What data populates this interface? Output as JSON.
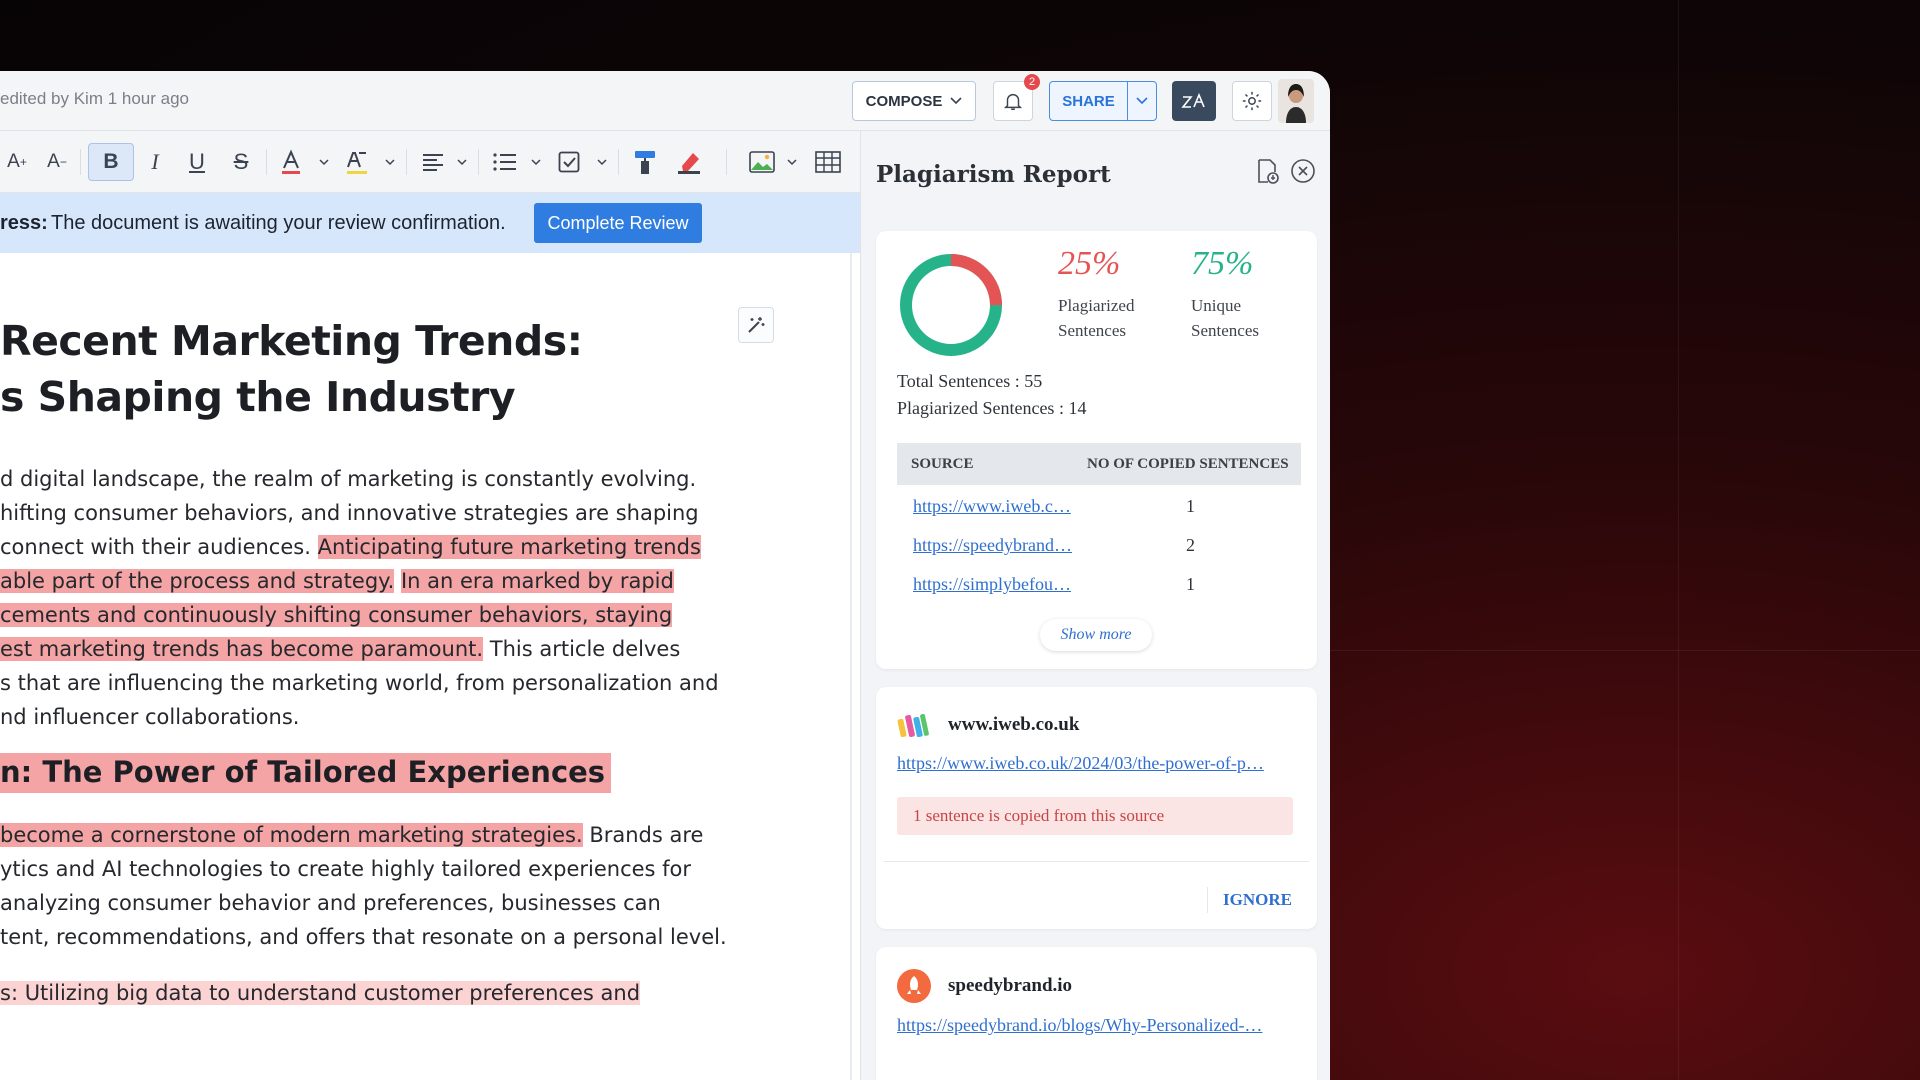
{
  "header": {
    "edited_text": "edited by Kim 1 hour ago",
    "compose_label": "COMPOSE",
    "notification_count": "2",
    "share_label": "SHARE"
  },
  "review_bar": {
    "label": "ress:",
    "message": "The document is awaiting your review confirmation.",
    "button": "Complete Review"
  },
  "document": {
    "title_line1": "Recent Marketing Trends:",
    "title_line2": "s Shaping the Industry",
    "para1": {
      "l1": "d digital landscape, the realm of marketing is constantly evolving.",
      "l2": "hifting consumer behaviors, and innovative strategies are shaping",
      "l3a": "connect with their audiences.",
      "l3b": "Anticipating future marketing trends",
      "l4a": "able part of the process and strategy.",
      "l4b": "In an era marked by rapid",
      "l5": "cements and continuously shifting consumer behaviors, staying",
      "l6a": "est marketing trends has become paramount.",
      "l6b": "This article delves",
      "l7": "s that are influencing the marketing world, from personalization and",
      "l8": "nd influencer collaborations."
    },
    "heading2": "n: The Power of Tailored Experiences",
    "para2": {
      "l1a": "become a cornerstone of modern marketing strategies.",
      "l1b": "Brands are",
      "l2": "ytics and AI technologies to create highly tailored experiences for",
      "l3": "analyzing consumer behavior and preferences, businesses can",
      "l4": "tent, recommendations, and offers that resonate on a personal level."
    },
    "para3": "s: Utilizing big data to understand customer preferences and"
  },
  "report": {
    "title": "Plagiarism Report",
    "plagiarized_pct": "25%",
    "plagiarized_label_1": "Plagiarized",
    "plagiarized_label_2": "Sentences",
    "unique_pct": "75%",
    "unique_label_1": "Unique",
    "unique_label_2": "Sentences",
    "plagiarized_fraction": 0.25,
    "total_sentences": "Total Sentences : 55",
    "plagiarized_sentences": "Plagiarized Sentences : 14",
    "col_source": "SOURCE",
    "col_count": "NO OF COPIED SENTENCES",
    "rows": [
      {
        "source": "https://www.iweb.c…",
        "count": "1"
      },
      {
        "source": "https://speedybrand…",
        "count": "2"
      },
      {
        "source": "https://simplybefou…",
        "count": "1"
      }
    ],
    "show_more": "Show more",
    "sources": [
      {
        "name": "www.iweb.co.uk",
        "url": "https://www.iweb.co.uk/2024/03/the-power-of-p…",
        "copied": "1 sentence is copied from this source",
        "action": "IGNORE"
      },
      {
        "name": "speedybrand.io",
        "url": "https://speedybrand.io/blogs/Why-Personalized-…"
      }
    ]
  },
  "colors": {
    "plagiarized": "#e55454",
    "unique": "#26b38a",
    "highlight": "#f4a4a4",
    "accent": "#2f7de1"
  }
}
